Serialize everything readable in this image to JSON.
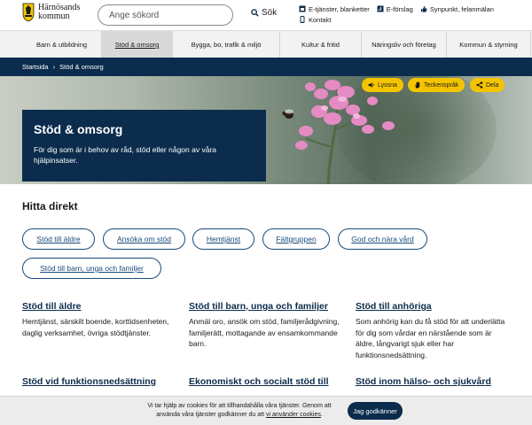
{
  "header": {
    "logo_line1": "Härnösands",
    "logo_line2": "kommun",
    "search_placeholder": "Ange sökord",
    "search_label": "Sök",
    "links": [
      "E-tjänster, blanketter",
      "E-förslag",
      "Synpunkt, felanmälan",
      "Kontakt"
    ]
  },
  "nav": {
    "items": [
      "Barn & utbildning",
      "Stöd & omsorg",
      "Bygga, bo, trafik & miljö",
      "Kultur & fritid",
      "Näringsliv och företag",
      "Kommun & styrning"
    ]
  },
  "breadcrumb": {
    "home": "Startsida",
    "separator": "›",
    "current": "Stöd & omsorg"
  },
  "hero": {
    "tools": [
      "Lyssna",
      "Teckenspråk",
      "Dela"
    ],
    "title": "Stöd & omsorg",
    "lead": "För dig som är i behov av råd, stöd eller någon av våra hjälpinsatser."
  },
  "hitta": {
    "heading": "Hitta direkt",
    "chips": [
      "Stöd till äldre",
      "Ansöka om stöd",
      "Hemtjänst",
      "Fältgruppen",
      "God och nära vård",
      "Stöd till barn, unga och familjer"
    ]
  },
  "cards": [
    {
      "title": "Stöd till äldre",
      "desc": "Hemtjänst, särskilt boende, korttidsenheten, daglig verksamhet, övriga stödtjänster."
    },
    {
      "title": "Stöd till barn, unga och familjer",
      "desc": "Anmäl oro, ansök om stöd, familjerådgivning, familjerätt, mottagande av ensamkommande barn."
    },
    {
      "title": "Stöd till anhöriga",
      "desc": "Som anhörig kan du få stöd för att underlätta för dig som vårdar en närstående som är äldre, långvarigt sjuk eller har funktionsnedsättning."
    },
    {
      "title": "Stöd vid funktionsnedsättning",
      "desc": ""
    },
    {
      "title": "Ekonomiskt och socialt stöd till",
      "desc": ""
    },
    {
      "title": "Stöd inom hälso- och sjukvård",
      "desc": ""
    }
  ],
  "cookie": {
    "text_line1": "Vi tar hjälp av cookies för att tillhandahålla våra tjänster. Genom att",
    "text_line2_pre": "använda våra tjänster godkänner du att ",
    "text_link": "vi använder cookies",
    "text_line2_post": ".",
    "accept_label": "Jag godkänner"
  },
  "colors": {
    "navy": "#0b2c4c",
    "accent_yellow": "#f5c400",
    "link": "#1a4a7a"
  }
}
